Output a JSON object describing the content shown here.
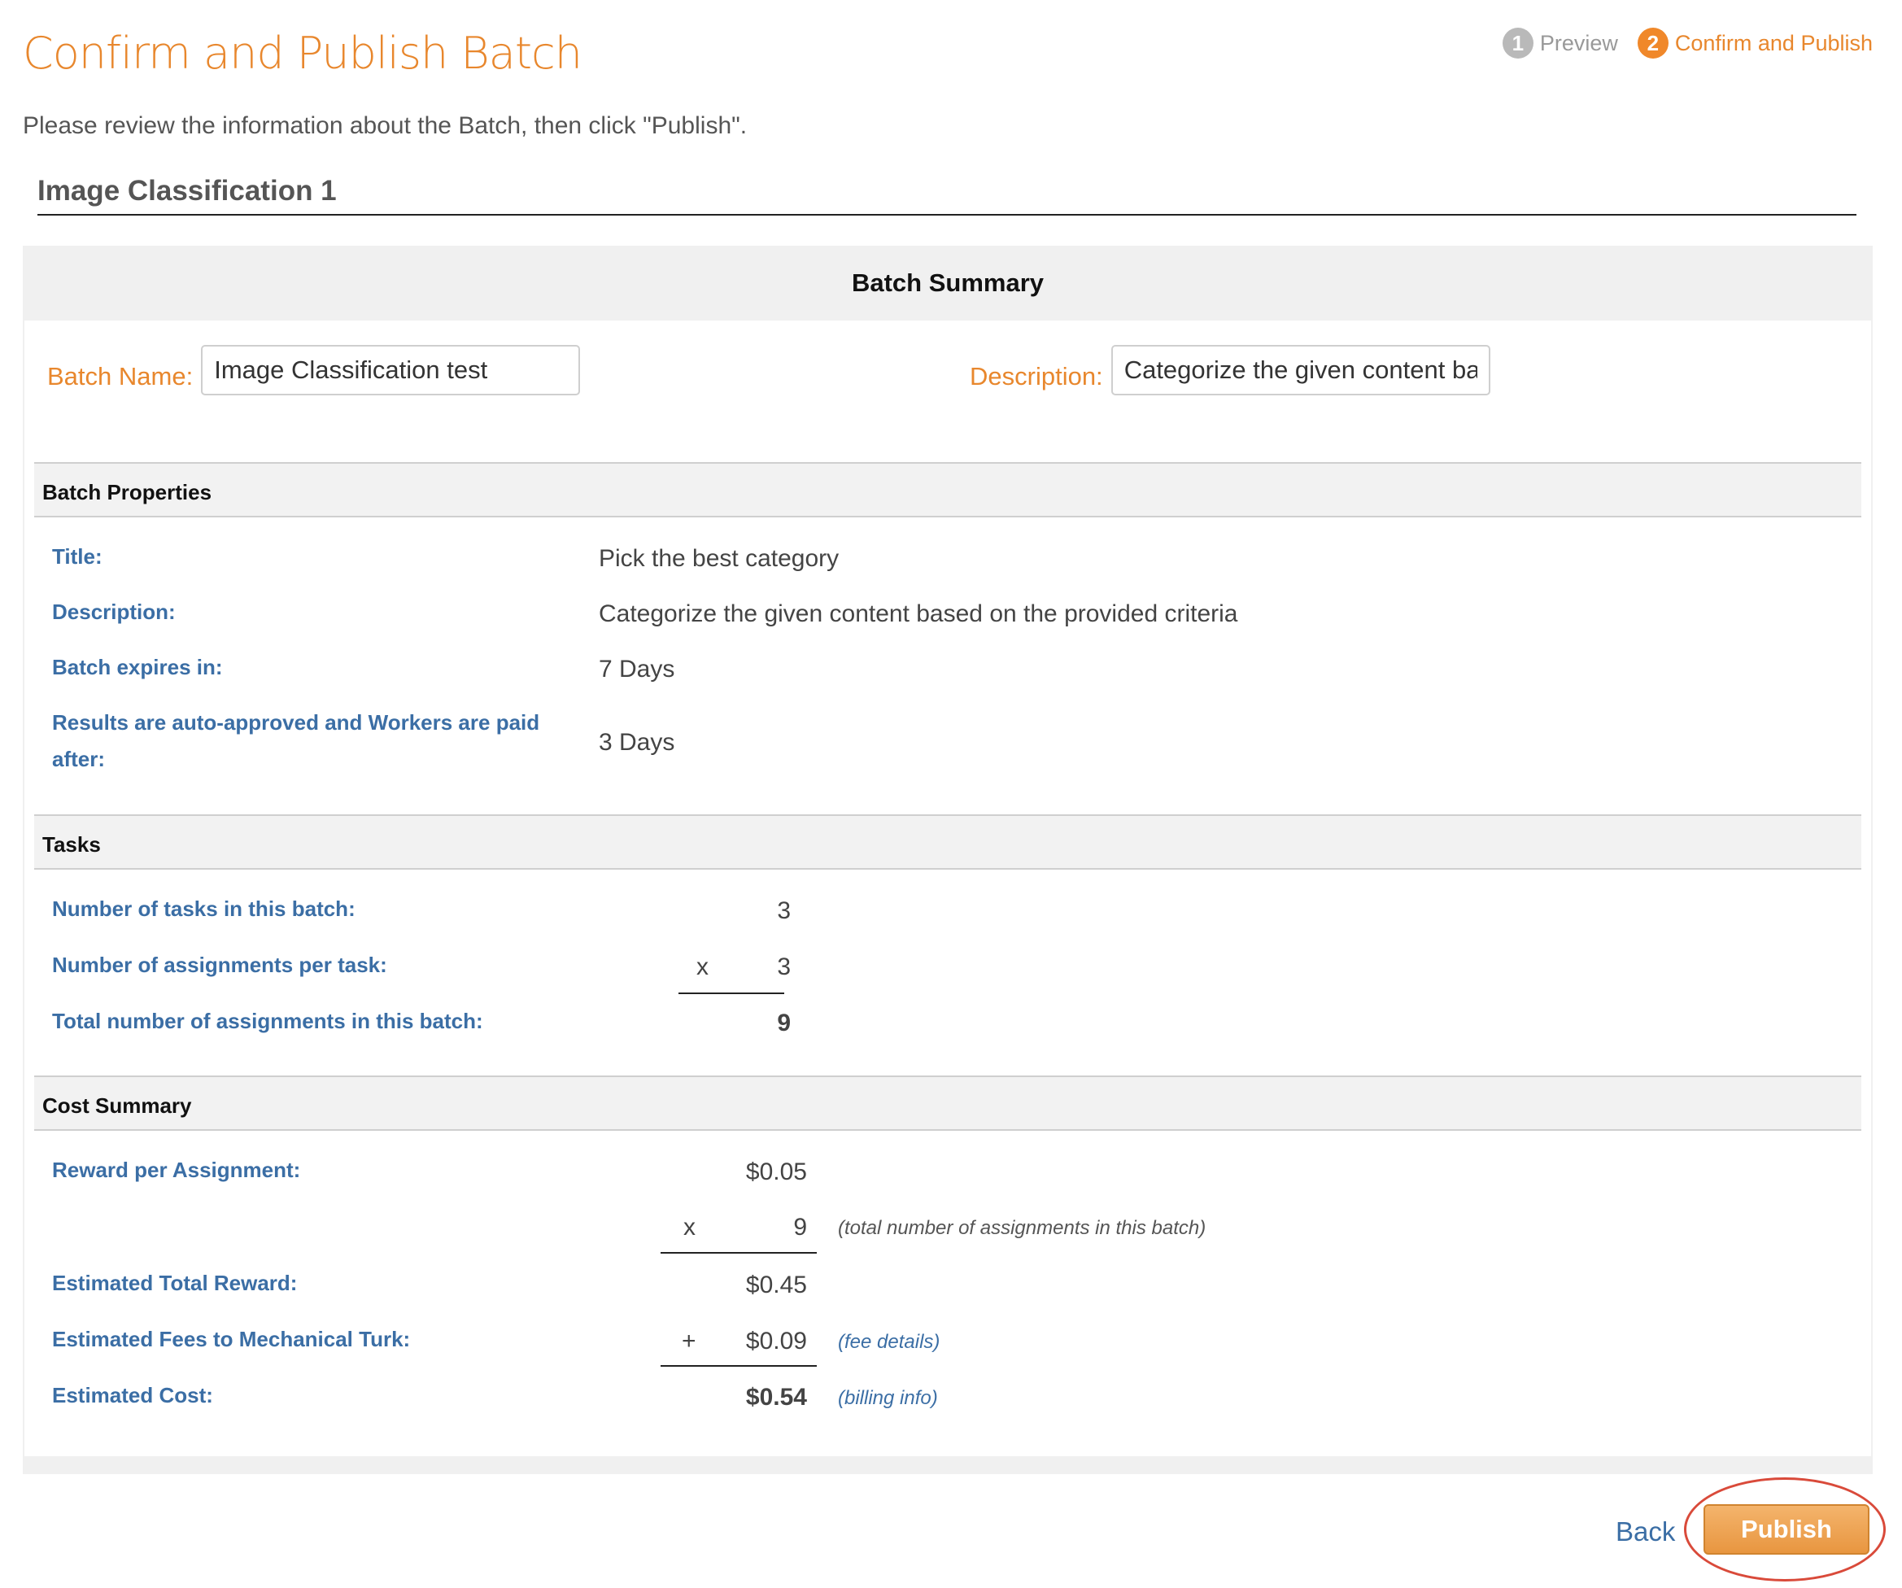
{
  "header": {
    "title": "Confirm and Publish Batch",
    "steps": [
      {
        "num": "1",
        "label": "Preview"
      },
      {
        "num": "2",
        "label": "Confirm and Publish"
      }
    ],
    "instructions": "Please review the information about the Batch, then click \"Publish\"."
  },
  "batch_heading": "Image Classification 1",
  "summary": {
    "title": "Batch Summary",
    "batch_name_label": "Batch Name:",
    "batch_name_value": "Image Classification test",
    "description_label": "Description:",
    "description_value": "Categorize the given content bas"
  },
  "properties": {
    "title": "Batch Properties",
    "rows": [
      {
        "label": "Title:",
        "value": "Pick the best category"
      },
      {
        "label": "Description:",
        "value": "Categorize the given content based on the provided criteria"
      },
      {
        "label": "Batch expires in:",
        "value": "7 Days"
      },
      {
        "label": "Results are auto-approved and Workers are paid",
        "label2": "after:",
        "value": "3 Days"
      }
    ]
  },
  "tasks": {
    "title": "Tasks",
    "num_tasks_label": "Number of tasks in this batch:",
    "num_tasks_value": "3",
    "assignments_label": "Number of assignments per task:",
    "assignments_op": "x",
    "assignments_value": "3",
    "total_label": "Total number of assignments in this batch:",
    "total_value": "9"
  },
  "cost": {
    "title": "Cost Summary",
    "reward_label": "Reward per Assignment:",
    "reward_value": "$0.05",
    "multiplier_op": "x",
    "multiplier_value": "9",
    "multiplier_note": "(total number of assignments in this batch)",
    "total_reward_label": "Estimated Total Reward:",
    "total_reward_value": "$0.45",
    "fees_label": "Estimated Fees to Mechanical Turk:",
    "fees_op": "+",
    "fees_value": "$0.09",
    "fees_link": "(fee details)",
    "estimated_cost_label": "Estimated Cost:",
    "estimated_cost_value": "$0.54",
    "billing_link": "(billing info)"
  },
  "footer": {
    "back_label": "Back",
    "publish_label": "Publish"
  },
  "colors": {
    "accent": "#e8872d",
    "label_blue": "#3b6ea5",
    "highlight_ring": "#d94a3a"
  }
}
